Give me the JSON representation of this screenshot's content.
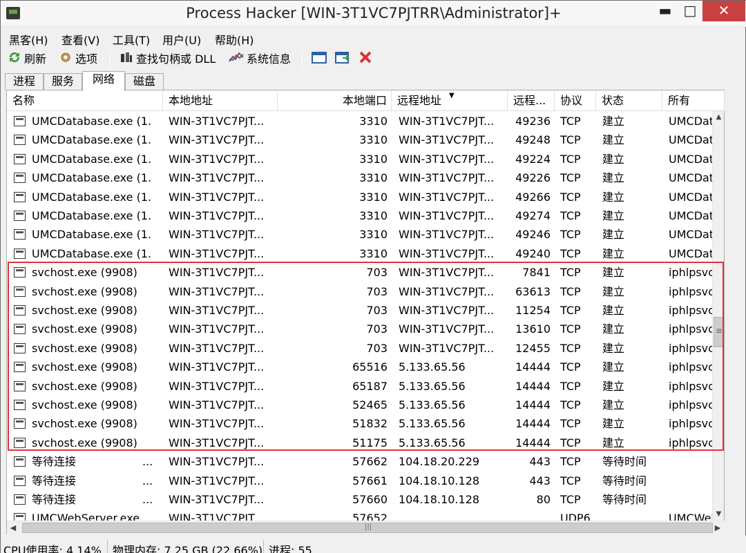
{
  "window": {
    "title": "Process Hacker [WIN-3T1VC7PJTRR\\Administrator]+",
    "minimize": "▬",
    "maximize": "□",
    "close": "✕"
  },
  "menu": [
    "黑客(H)",
    "查看(V)",
    "工具(T)",
    "用户(U)",
    "帮助(H)"
  ],
  "toolbar": {
    "refresh": "刷新",
    "options": "选项",
    "find": "查找句柄或 DLL",
    "sysinfo": "系统信息",
    "icons": [
      "refresh-icon",
      "options-icon",
      "find-handles-icon",
      "system-info-icon",
      "window-icon",
      "restore-window-icon",
      "close-x-icon"
    ]
  },
  "tabs": [
    "进程",
    "服务",
    "网络",
    "磁盘"
  ],
  "active_tab": "网络",
  "columns": [
    "名称",
    "本地地址",
    "本地端口",
    "远程地址",
    "远程...",
    "协议",
    "状态",
    "所有"
  ],
  "rows": [
    {
      "name": "UMCDatabase.exe (1...",
      "local_addr": "WIN-3T1VC7PJT...",
      "local_port": "3310",
      "remote_addr": "WIN-3T1VC7PJT...",
      "remote_port": "49236",
      "protocol": "TCP",
      "state": "建立",
      "owner": "UMCData.",
      "ellipsis": ""
    },
    {
      "name": "UMCDatabase.exe (1...",
      "local_addr": "WIN-3T1VC7PJT...",
      "local_port": "3310",
      "remote_addr": "WIN-3T1VC7PJT...",
      "remote_port": "49248",
      "protocol": "TCP",
      "state": "建立",
      "owner": "UMCData.",
      "ellipsis": ""
    },
    {
      "name": "UMCDatabase.exe (1...",
      "local_addr": "WIN-3T1VC7PJT...",
      "local_port": "3310",
      "remote_addr": "WIN-3T1VC7PJT...",
      "remote_port": "49224",
      "protocol": "TCP",
      "state": "建立",
      "owner": "UMCData.",
      "ellipsis": ""
    },
    {
      "name": "UMCDatabase.exe (1...",
      "local_addr": "WIN-3T1VC7PJT...",
      "local_port": "3310",
      "remote_addr": "WIN-3T1VC7PJT...",
      "remote_port": "49226",
      "protocol": "TCP",
      "state": "建立",
      "owner": "UMCData.",
      "ellipsis": ""
    },
    {
      "name": "UMCDatabase.exe (1...",
      "local_addr": "WIN-3T1VC7PJT...",
      "local_port": "3310",
      "remote_addr": "WIN-3T1VC7PJT...",
      "remote_port": "49266",
      "protocol": "TCP",
      "state": "建立",
      "owner": "UMCData.",
      "ellipsis": ""
    },
    {
      "name": "UMCDatabase.exe (1...",
      "local_addr": "WIN-3T1VC7PJT...",
      "local_port": "3310",
      "remote_addr": "WIN-3T1VC7PJT...",
      "remote_port": "49274",
      "protocol": "TCP",
      "state": "建立",
      "owner": "UMCData.",
      "ellipsis": ""
    },
    {
      "name": "UMCDatabase.exe (1...",
      "local_addr": "WIN-3T1VC7PJT...",
      "local_port": "3310",
      "remote_addr": "WIN-3T1VC7PJT...",
      "remote_port": "49246",
      "protocol": "TCP",
      "state": "建立",
      "owner": "UMCData.",
      "ellipsis": ""
    },
    {
      "name": "UMCDatabase.exe (1...",
      "local_addr": "WIN-3T1VC7PJT...",
      "local_port": "3310",
      "remote_addr": "WIN-3T1VC7PJT...",
      "remote_port": "49240",
      "protocol": "TCP",
      "state": "建立",
      "owner": "UMCData.",
      "ellipsis": ""
    },
    {
      "name": "svchost.exe (9908)",
      "local_addr": "WIN-3T1VC7PJT...",
      "local_port": "703",
      "remote_addr": "WIN-3T1VC7PJT...",
      "remote_port": "7841",
      "protocol": "TCP",
      "state": "建立",
      "owner": "iphlpsvc",
      "ellipsis": ""
    },
    {
      "name": "svchost.exe (9908)",
      "local_addr": "WIN-3T1VC7PJT...",
      "local_port": "703",
      "remote_addr": "WIN-3T1VC7PJT...",
      "remote_port": "63613",
      "protocol": "TCP",
      "state": "建立",
      "owner": "iphlpsvc",
      "ellipsis": ""
    },
    {
      "name": "svchost.exe (9908)",
      "local_addr": "WIN-3T1VC7PJT...",
      "local_port": "703",
      "remote_addr": "WIN-3T1VC7PJT...",
      "remote_port": "11254",
      "protocol": "TCP",
      "state": "建立",
      "owner": "iphlpsvc",
      "ellipsis": ""
    },
    {
      "name": "svchost.exe (9908)",
      "local_addr": "WIN-3T1VC7PJT...",
      "local_port": "703",
      "remote_addr": "WIN-3T1VC7PJT...",
      "remote_port": "13610",
      "protocol": "TCP",
      "state": "建立",
      "owner": "iphlpsvc",
      "ellipsis": ""
    },
    {
      "name": "svchost.exe (9908)",
      "local_addr": "WIN-3T1VC7PJT...",
      "local_port": "703",
      "remote_addr": "WIN-3T1VC7PJT...",
      "remote_port": "12455",
      "protocol": "TCP",
      "state": "建立",
      "owner": "iphlpsvc",
      "ellipsis": ""
    },
    {
      "name": "svchost.exe (9908)",
      "local_addr": "WIN-3T1VC7PJT...",
      "local_port": "65516",
      "remote_addr": "5.133.65.56",
      "remote_port": "14444",
      "protocol": "TCP",
      "state": "建立",
      "owner": "iphlpsvc",
      "ellipsis": ""
    },
    {
      "name": "svchost.exe (9908)",
      "local_addr": "WIN-3T1VC7PJT...",
      "local_port": "65187",
      "remote_addr": "5.133.65.56",
      "remote_port": "14444",
      "protocol": "TCP",
      "state": "建立",
      "owner": "iphlpsvc",
      "ellipsis": ""
    },
    {
      "name": "svchost.exe (9908)",
      "local_addr": "WIN-3T1VC7PJT...",
      "local_port": "52465",
      "remote_addr": "5.133.65.56",
      "remote_port": "14444",
      "protocol": "TCP",
      "state": "建立",
      "owner": "iphlpsvc",
      "ellipsis": ""
    },
    {
      "name": "svchost.exe (9908)",
      "local_addr": "WIN-3T1VC7PJT...",
      "local_port": "51832",
      "remote_addr": "5.133.65.56",
      "remote_port": "14444",
      "protocol": "TCP",
      "state": "建立",
      "owner": "iphlpsvc",
      "ellipsis": ""
    },
    {
      "name": "svchost.exe (9908)",
      "local_addr": "WIN-3T1VC7PJT...",
      "local_port": "51175",
      "remote_addr": "5.133.65.56",
      "remote_port": "14444",
      "protocol": "TCP",
      "state": "建立",
      "owner": "iphlpsvc",
      "ellipsis": ""
    },
    {
      "name": "等待连接",
      "local_addr": "WIN-3T1VC7PJT...",
      "local_port": "57662",
      "remote_addr": "104.18.20.229",
      "remote_port": "443",
      "protocol": "TCP",
      "state": "等待时间",
      "owner": "",
      "ellipsis": "..."
    },
    {
      "name": "等待连接",
      "local_addr": "WIN-3T1VC7PJT...",
      "local_port": "57661",
      "remote_addr": "104.18.10.128",
      "remote_port": "443",
      "protocol": "TCP",
      "state": "等待时间",
      "owner": "",
      "ellipsis": "..."
    },
    {
      "name": "等待连接",
      "local_addr": "WIN-3T1VC7PJT...",
      "local_port": "57660",
      "remote_addr": "104.18.10.128",
      "remote_port": "80",
      "protocol": "TCP",
      "state": "等待时间",
      "owner": "",
      "ellipsis": "..."
    },
    {
      "name": "UMCWebServer.exe",
      "local_addr": "WIN-3T1VC7PJT...",
      "local_port": "57652",
      "remote_addr": "",
      "remote_port": "",
      "protocol": "UDP6",
      "state": "",
      "owner": "UMCWeb",
      "ellipsis": ""
    }
  ],
  "status": {
    "cpu": "CPU使用率: 4.14%",
    "memory": "物理内存: 7.25 GB (22.66%)",
    "processes": "进程: 55"
  },
  "colors": {
    "highlight_border": "#e2303a",
    "close_button": "#c94040"
  }
}
